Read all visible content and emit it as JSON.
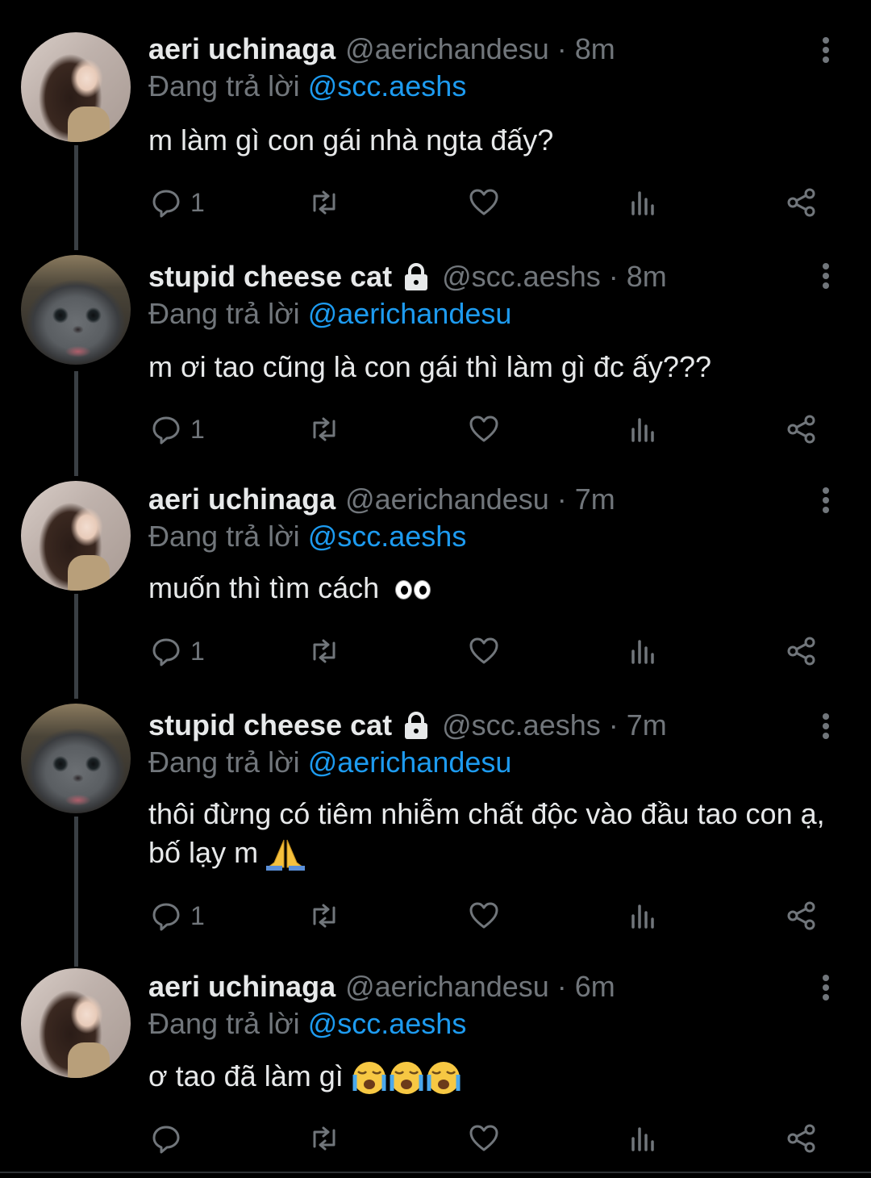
{
  "tweets": [
    {
      "name": "aeri uchinaga",
      "handle_time": "@aerichandesu · 8m",
      "reply_prefix": "Đang trả lời",
      "reply_to": "@scc.aeshs",
      "text": "m làm gì con gái nhà ngta đấy?",
      "reply_count": "1",
      "locked": false,
      "avatar": "aeri"
    },
    {
      "name": "stupid cheese cat",
      "handle_time": "@scc.aeshs · 8m",
      "reply_prefix": "Đang trả lời",
      "reply_to": "@aerichandesu",
      "text": "m ơi tao cũng là con gái thì làm gì đc ấy???",
      "reply_count": "1",
      "locked": true,
      "avatar": "cat"
    },
    {
      "name": "aeri uchinaga",
      "handle_time": "@aerichandesu · 7m",
      "reply_prefix": "Đang trả lời",
      "reply_to": "@scc.aeshs",
      "text": "muốn thì tìm cách",
      "emoji": "eyes",
      "reply_count": "1",
      "locked": false,
      "avatar": "aeri"
    },
    {
      "name": "stupid cheese cat",
      "handle_time": "@scc.aeshs · 7m",
      "reply_prefix": "Đang trả lời",
      "reply_to": "@aerichandesu",
      "text": "thôi đừng có tiêm nhiễm chất độc vào đầu tao con ạ, bố lạy m",
      "emoji": "pray",
      "reply_count": "1",
      "locked": true,
      "avatar": "cat"
    },
    {
      "name": "aeri uchinaga",
      "handle_time": "@aerichandesu · 6m",
      "reply_prefix": "Đang trả lời",
      "reply_to": "@scc.aeshs",
      "text": "ơ tao đã làm gì",
      "emoji": "cry-x3",
      "reply_count": "",
      "locked": false,
      "avatar": "aeri"
    }
  ],
  "icons": {
    "reply": "reply-bubble-icon",
    "retweet": "retweet-icon",
    "like": "heart-icon",
    "views": "analytics-icon",
    "share": "share-icon",
    "more": "more-vertical-icon",
    "lock": "lock-icon"
  },
  "colors": {
    "background": "#000000",
    "text": "#e7e9ea",
    "muted": "#71767b",
    "mention": "#1d9bf0",
    "thread_line": "#3a3f44"
  }
}
